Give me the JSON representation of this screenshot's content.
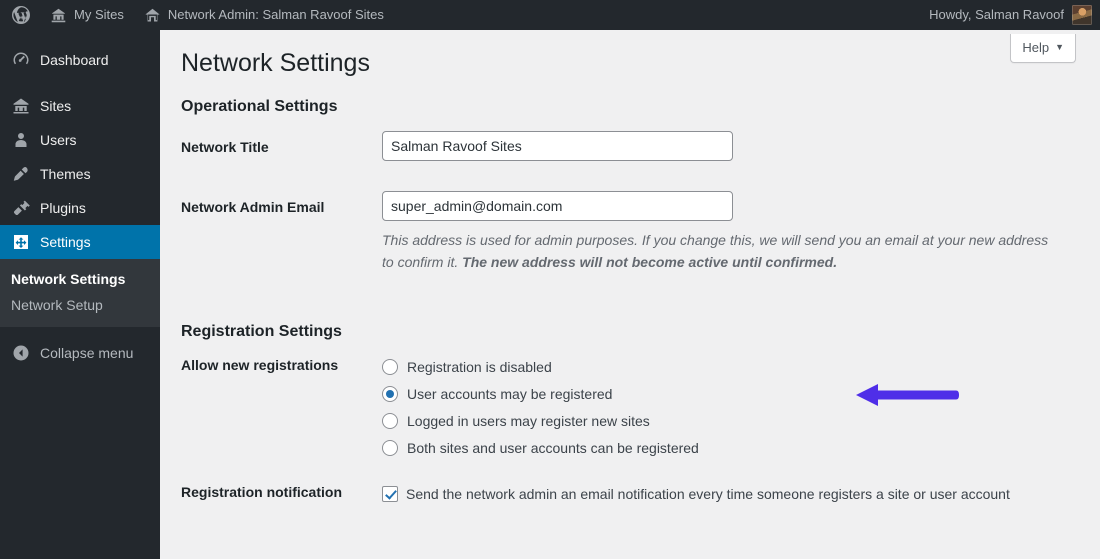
{
  "adminbar": {
    "logo_icon": "wordpress-logo-icon",
    "my_sites": {
      "label": "My Sites",
      "icon": "sites-icon"
    },
    "network_admin": {
      "label": "Network Admin: Salman Ravoof Sites",
      "icon": "home-icon"
    },
    "howdy": "Howdy, Salman Ravoof",
    "avatar_alt": "user-avatar"
  },
  "sidebar": {
    "items": [
      {
        "label": "Dashboard",
        "icon": "dashboard-icon"
      },
      {
        "label": "Sites",
        "icon": "sites-icon"
      },
      {
        "label": "Users",
        "icon": "users-icon"
      },
      {
        "label": "Themes",
        "icon": "themes-icon"
      },
      {
        "label": "Plugins",
        "icon": "plugins-icon"
      },
      {
        "label": "Settings",
        "icon": "settings-icon"
      }
    ],
    "submenu": [
      {
        "label": "Network Settings",
        "current": true
      },
      {
        "label": "Network Setup",
        "current": false
      }
    ],
    "collapse": {
      "label": "Collapse menu",
      "icon": "collapse-arrow-icon"
    },
    "highlight_color": "#0073aa"
  },
  "content": {
    "help_button": {
      "label": "Help",
      "caret": "▼"
    },
    "page_title": "Network Settings",
    "sections": [
      {
        "title": "Operational Settings"
      },
      {
        "title": "Registration Settings"
      }
    ],
    "fields": {
      "network_title": {
        "label": "Network Title",
        "value": "Salman Ravoof Sites",
        "placeholder": ""
      },
      "network_admin_email": {
        "label": "Network Admin Email",
        "value": "super_admin@domain.com",
        "placeholder": "",
        "description_normal": "This address is used for admin purposes. If you change this, we will send you an email at your new address to confirm it. ",
        "description_bold": "The new address will not become active until confirmed."
      },
      "allow_new_registrations": {
        "label": "Allow new registrations",
        "options": [
          {
            "label": "Registration is disabled",
            "selected": false
          },
          {
            "label": "User accounts may be registered",
            "selected": true
          },
          {
            "label": "Logged in users may register new sites",
            "selected": false
          },
          {
            "label": "Both sites and user accounts can be registered",
            "selected": false
          }
        ]
      },
      "registration_notification": {
        "label": "Registration notification",
        "checkbox_label": "Send the network admin an email notification every time someone registers a site or user account",
        "checked": true
      }
    },
    "annotation": {
      "type": "arrow",
      "points_to": "User accounts may be registered",
      "color": "#4f2ee8"
    }
  },
  "colors": {
    "admin_bar_bg": "#23282d",
    "sidebar_bg": "#23282d",
    "submenu_bg": "#32373c",
    "content_bg": "#f0f0f1",
    "accent_blue": "#2271b1",
    "annotation_purple": "#4f2ee8"
  }
}
